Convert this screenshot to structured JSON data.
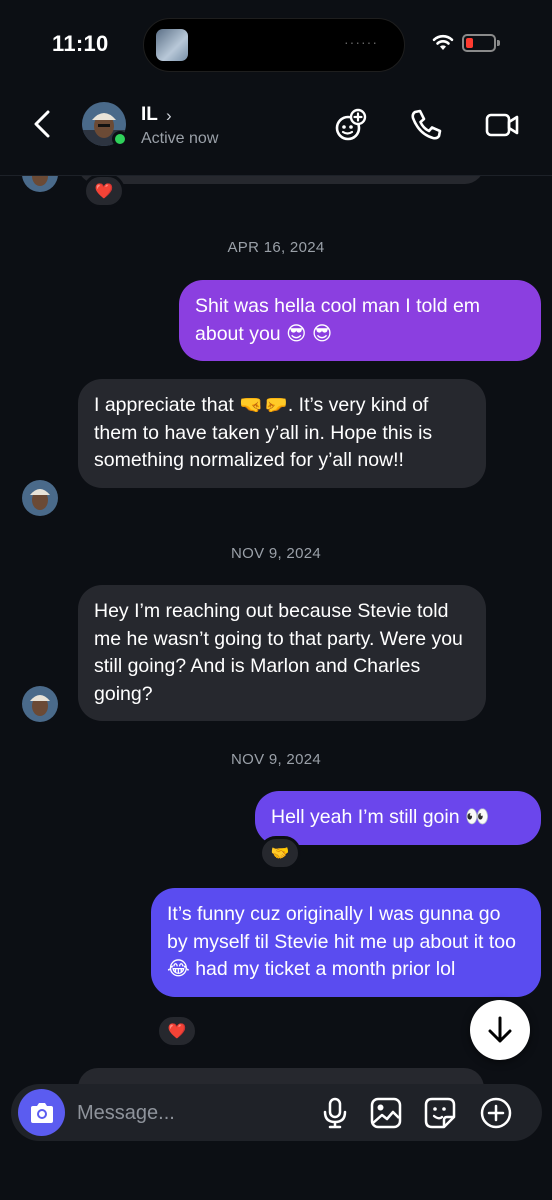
{
  "status_bar": {
    "time": "11:10",
    "battery_color": "#ff3b30"
  },
  "header": {
    "name": "IL",
    "status": "Active now",
    "icons": [
      "back-icon",
      "group-add-icon",
      "phone-icon",
      "video-icon"
    ]
  },
  "messages": {
    "sep1": "APR 16, 2024",
    "m1": "Shit was hella cool man I told em about you 😎 😎",
    "m2": "I appreciate that 🤜🤛. It’s very kind of them to have taken y’all in. Hope this is something normalized for y’all now!!",
    "sep2": "NOV 9, 2024",
    "m3": "Hey I’m reaching out because Stevie told me he wasn’t going to that party. Were you still going? And is Marlon and Charles going?",
    "sep3": "NOV 9, 2024",
    "m4": "Hell yeah I’m still goin 👀",
    "m4_reaction": "🤝",
    "m5": "It’s funny cuz originally I was gunna go by myself til Stevie hit me up about it too😂  had my ticket a month prior lol",
    "top_reaction": "❤️",
    "m5_reaction": "❤️"
  },
  "composer": {
    "placeholder": "Message..."
  },
  "colors": {
    "outgoing_top": "#8b3fe0",
    "outgoing_bottom": "#5b4cf0",
    "incoming": "#26282e",
    "accent": "#5b5cf0"
  }
}
